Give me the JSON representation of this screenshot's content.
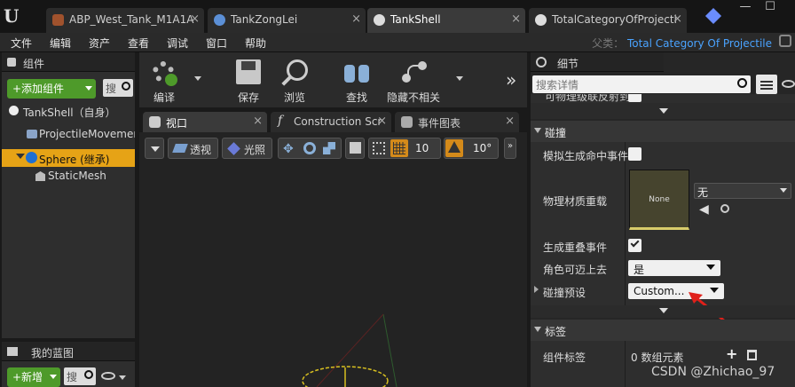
{
  "tabs": [
    {
      "label": "ABP_West_Tank_M1A1A",
      "icon": "anim-blueprint-icon"
    },
    {
      "label": "TankZongLei",
      "icon": "blueprint-class-icon"
    },
    {
      "label": "TankShell",
      "icon": "sphere-blueprint-icon"
    },
    {
      "label": "TotalCategoryOfProjecti",
      "icon": "sphere-blueprint-icon"
    }
  ],
  "menu": [
    "文件",
    "编辑",
    "资产",
    "查看",
    "调试",
    "窗口",
    "帮助"
  ],
  "parent_label": "父类：",
  "parent_value": "Total Category Of Projectile",
  "components": {
    "header": "组件",
    "add_button": "+添加组件",
    "search_placeholder": "搜",
    "items": [
      "TankShell（自身）",
      "ProjectileMovemen",
      "Sphere (继承)",
      "StaticMesh"
    ]
  },
  "blueprints": {
    "header": "我的蓝图",
    "new_button": "+新增",
    "search_placeholder": "搜"
  },
  "toolbar": [
    "编译",
    "保存",
    "浏览",
    "查找",
    "隐藏不相关"
  ],
  "editor_tabs": [
    "视口",
    "Construction Scr",
    "事件图表"
  ],
  "viewport": {
    "perspective": "透视",
    "lit": "光照",
    "grid_snap": "10",
    "rot_snap": "10°"
  },
  "details": {
    "header": "细节",
    "search_placeholder": "搜索详情",
    "truncated_row": "可物理级联反射到",
    "collision_section": "碰撞",
    "sim_hit_label": "模拟生成命中事件",
    "phys_mat_label": "物理材质重载",
    "phys_mat_thumb": "None",
    "phys_mat_value": "无",
    "overlap_label": "生成重叠事件",
    "overlap_checked": true,
    "step_up_label": "角色可迈上去",
    "step_up_value": "是",
    "preset_label": "碰撞预设",
    "preset_value": "Custom...",
    "tags_section": "标签",
    "component_tags_label": "组件标签",
    "component_tags_value": "0 数组元素"
  },
  "watermark": "CSDN @Zhichao_97"
}
